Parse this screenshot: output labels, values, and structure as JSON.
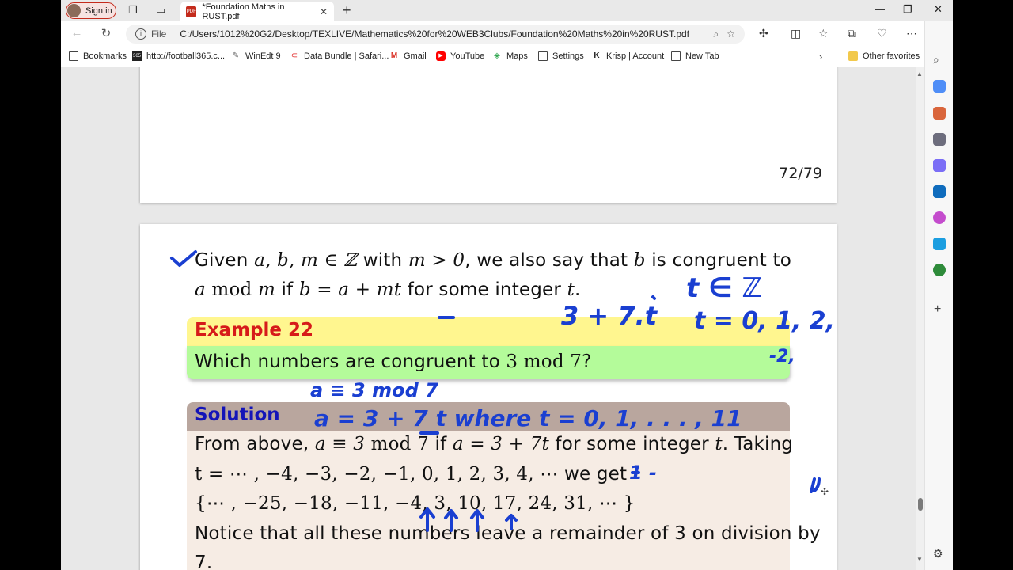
{
  "browser": {
    "profile_label": "Sign in",
    "tab_title": "*Foundation Maths in RUST.pdf",
    "file_label": "File",
    "address": "C:/Users/1012%20G2/Desktop/TEXLIVE/Mathematics%20for%20WEB3Clubs/Foundation%20Maths%20in%20RUST.pdf",
    "bookmarks": [
      {
        "label": "Bookmarks",
        "icon": "bookmark-icon"
      },
      {
        "label": "http://football365.c...",
        "icon": "football365-favicon"
      },
      {
        "label": "WinEdt 9",
        "icon": "winedt-favicon"
      },
      {
        "label": "Data Bundle | Safari...",
        "icon": "safaricom-favicon"
      },
      {
        "label": "Gmail",
        "icon": "gmail-favicon"
      },
      {
        "label": "YouTube",
        "icon": "youtube-favicon"
      },
      {
        "label": "Maps",
        "icon": "maps-favicon"
      },
      {
        "label": "Settings",
        "icon": "page-icon"
      },
      {
        "label": "Krisp | Account",
        "icon": "krisp-favicon"
      },
      {
        "label": "New Tab",
        "icon": "page-icon"
      }
    ],
    "other_favorites": "Other favorites"
  },
  "document": {
    "page_number": "72/79",
    "intro_line1_a": "Given ",
    "intro_line1_math": "a, b, m ∈ ℤ",
    "intro_line1_b": " with ",
    "intro_line1_math2": "m > 0",
    "intro_line1_c": ", we also say that ",
    "intro_line1_math3": "b",
    "intro_line1_d": " is congruent to",
    "intro_line2_math": "a",
    "intro_line2_mod": " mod ",
    "intro_line2_math2": "m",
    "intro_line2_a": " if ",
    "intro_line2_math3": "b = a + mt",
    "intro_line2_b": " for some integer ",
    "intro_line2_math4": "t",
    "intro_line2_c": ".",
    "example_title": "Example 22",
    "example_text": "Which numbers are congruent to ",
    "example_math": "3",
    "example_mod": " mod ",
    "example_math2": "7",
    "example_end": "?",
    "solution_title": "Solution",
    "sol_l1_a": "From above, ",
    "sol_l1_m": "a ≡ 3",
    "sol_l1_mod": " mod ",
    "sol_l1_m2": "7",
    "sol_l1_b": " if ",
    "sol_l1_m3": "a = 3 + 7t",
    "sol_l1_c": " for some integer ",
    "sol_l1_m4": "t",
    "sol_l1_d": ". Taking",
    "sol_l2_m": "t = ⋯ , −4, −3, −2, −1, 0, 1, 2, 3, 4, ⋯",
    "sol_l2_a": " we get",
    "sol_l3_m": "{⋯ , −25, −18, −11, −4, 3, 10, 17, 24, 31, ⋯ }",
    "sol_l4": "Notice that all these numbers leave a remainder of 3 on division by",
    "sol_l5": "7."
  },
  "handwriting": {
    "t_in_z": "t ∈ ℤ",
    "t_values": "t = 0, 1, 2,",
    "neg": "-2,",
    "three_plus": "3 + 7.t",
    "a_congruent": "a ≡ 3 mod 7",
    "a_equals": "a = 3 + 7 t  where  t = 0, 1, . . . , 11",
    "one_dash": "1 -"
  },
  "colors": {
    "ink": "#1a3fd1",
    "example_title": "#d61a1a",
    "solution_title": "#1414b8"
  }
}
